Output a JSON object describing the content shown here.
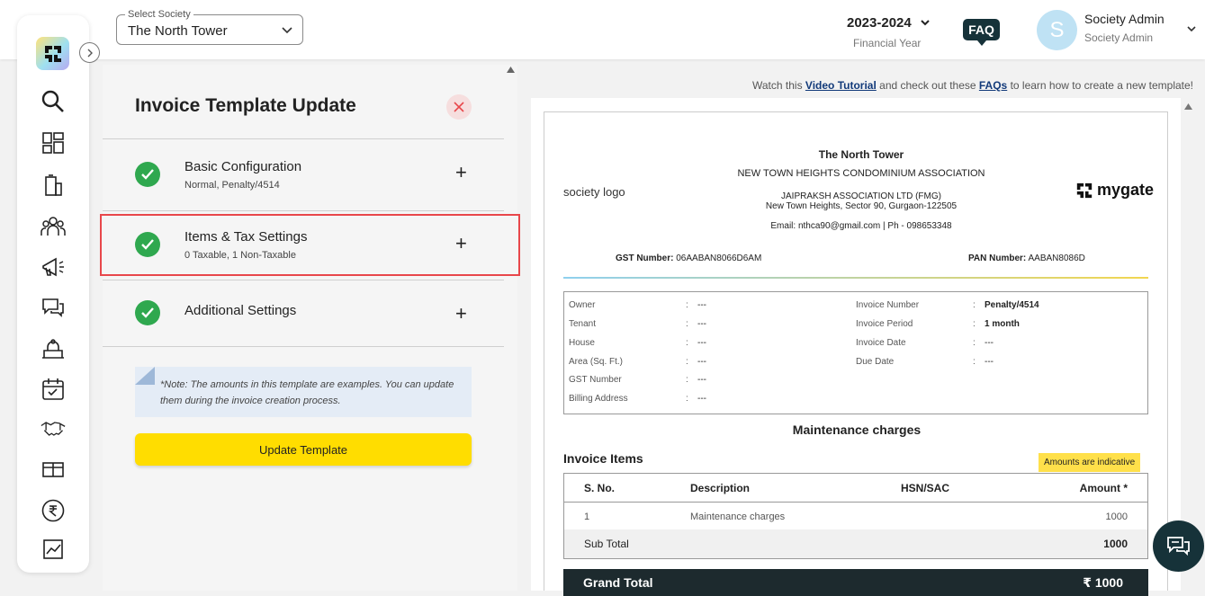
{
  "header": {
    "society_select_label": "Select Society",
    "society_select_value": "The North Tower",
    "financial_year": "2023-2024",
    "financial_year_label": "Financial Year",
    "faq_label": "FAQ",
    "avatar_initial": "S",
    "user_name": "Society Admin",
    "user_role": "Society Admin"
  },
  "sidebar": {
    "items": [
      "search-icon",
      "dashboard-icon",
      "building-icon",
      "residents-icon",
      "announcement-icon",
      "chat-icon",
      "amenities-icon",
      "calendar-icon",
      "handshake-icon",
      "gift-icon",
      "rupee-icon",
      "reports-icon"
    ]
  },
  "panel": {
    "title": "Invoice Template Update",
    "sections": [
      {
        "title": "Basic Configuration",
        "subtitle": "Normal, Penalty/4514"
      },
      {
        "title": "Items & Tax Settings",
        "subtitle": "0 Taxable, 1 Non-Taxable"
      },
      {
        "title": "Additional Settings",
        "subtitle": ""
      }
    ],
    "plus": "+",
    "note": "*Note: The amounts in this template are examples. You can update them during the invoice creation process.",
    "update_button": "Update Template"
  },
  "tutorial": {
    "prefix": "Watch this ",
    "video_link": "Video Tutorial",
    "middle": " and check out these ",
    "faq_link": "FAQs",
    "suffix": " to learn how to create a new template!"
  },
  "invoice": {
    "logo_alt": "society logo",
    "brand": "mygate",
    "society_name": "The North Tower",
    "association": "NEW TOWN HEIGHTS CONDOMINIUM ASSOCIATION",
    "company": "JAIPRAKSH ASSOCIATION LTD (FMG)",
    "address": "New Town Heights, Sector 90, Gurgaon-122505",
    "contact": "Email: nthca90@gmail.com | Ph - 098653348",
    "gst_label": "GST Number:",
    "gst_value": "06AABAN8066D6AM",
    "pan_label": "PAN Number:",
    "pan_value": "AABAN8086D",
    "details_left": [
      {
        "label": "Owner",
        "value": "---"
      },
      {
        "label": "Tenant",
        "value": "---"
      },
      {
        "label": "House",
        "value": "---"
      },
      {
        "label": "Area (Sq. Ft.)",
        "value": "---"
      },
      {
        "label": "GST Number",
        "value": "---"
      },
      {
        "label": "Billing Address",
        "value": "---"
      }
    ],
    "details_right": [
      {
        "label": "Invoice Number",
        "value": "Penalty/4514"
      },
      {
        "label": "Invoice Period",
        "value": "1 month"
      },
      {
        "label": "Invoice Date",
        "value": "---"
      },
      {
        "label": "Due Date",
        "value": "---"
      }
    ],
    "colon": ":",
    "charges_title": "Maintenance charges",
    "items_title": "Invoice Items",
    "indicative_badge": "Amounts are indicative",
    "columns": [
      "S. No.",
      "Description",
      "HSN/SAC",
      "Amount *"
    ],
    "rows": [
      {
        "sno": "1",
        "description": "Maintenance charges",
        "hsn": "",
        "amount": "1000"
      }
    ],
    "subtotal_label": "Sub Total",
    "subtotal_value": "1000",
    "grand_total_label": "Grand Total",
    "grand_total_value": "₹ 1000"
  },
  "colors": {
    "accent_yellow": "#FFDD00",
    "dark_teal": "#163239",
    "success_green": "#2FA84F",
    "highlight_red": "#E8474B"
  }
}
